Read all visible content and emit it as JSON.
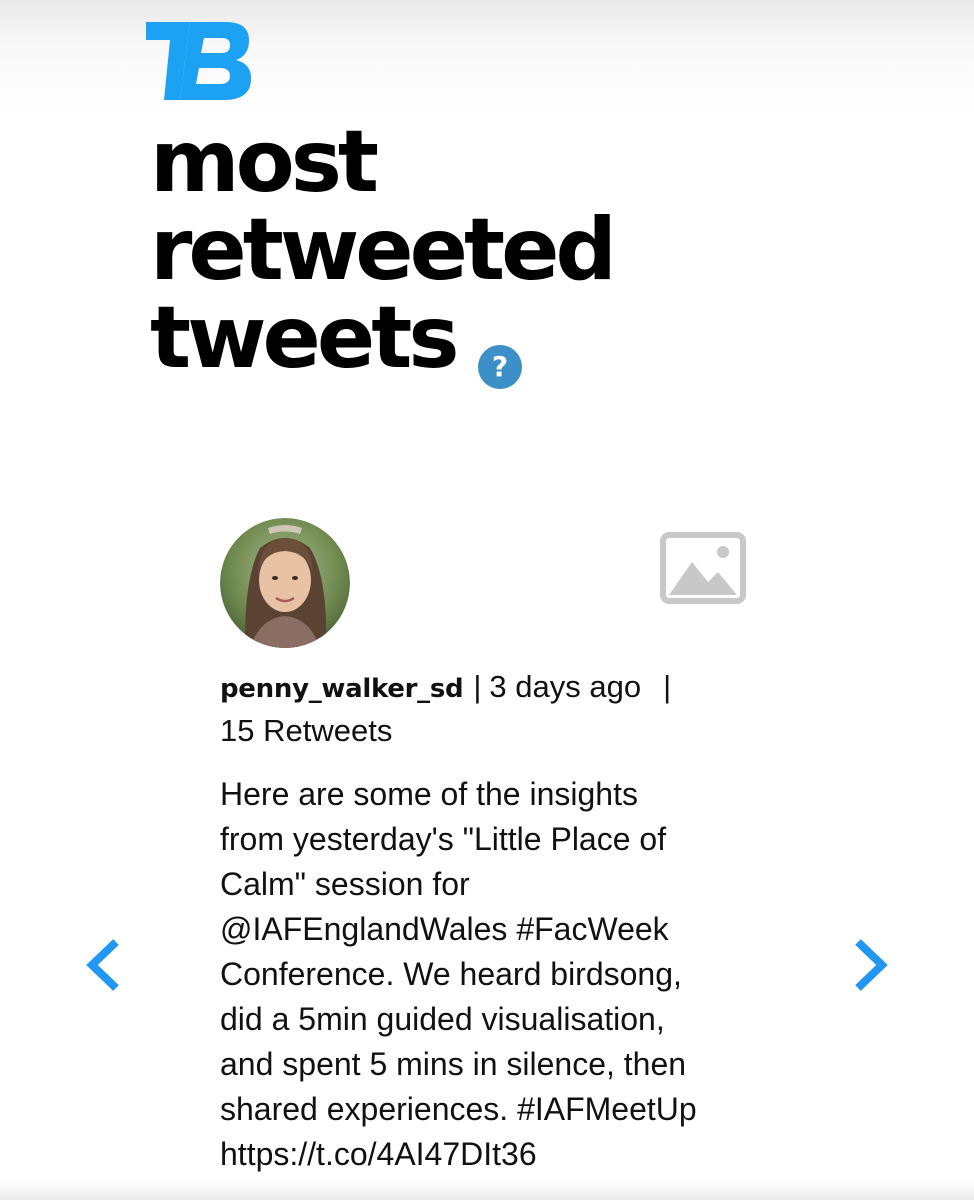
{
  "brand": {
    "logo_text": "TB",
    "accent_color": "#1da1f2"
  },
  "header": {
    "title_lines": [
      "most",
      "retweeted",
      "tweets"
    ],
    "help_icon_glyph": "?",
    "help_icon_color": "#3d8fc8"
  },
  "tweet": {
    "username": "penny_walker_sd",
    "separator": "|",
    "time_ago": "3 days ago",
    "retweets": "15 Retweets",
    "text_lines": [
      "Here are some of the insights",
      "from yesterday's \"Little Place of",
      "Calm\" session for",
      "@IAFEnglandWales #FacWeek",
      "Conference. We heard birdsong,",
      "did a 5min guided visualisation,",
      "and spent 5 mins in silence, then",
      "shared experiences. #IAFMeetUp",
      "https://t.co/4AI47DIt36"
    ],
    "avatar_icon": "profile-photo",
    "media_icon": "image-placeholder-icon"
  },
  "nav": {
    "prev_icon": "chevron-left-icon",
    "next_icon": "chevron-right-icon",
    "arrow_color": "#2196f3"
  }
}
